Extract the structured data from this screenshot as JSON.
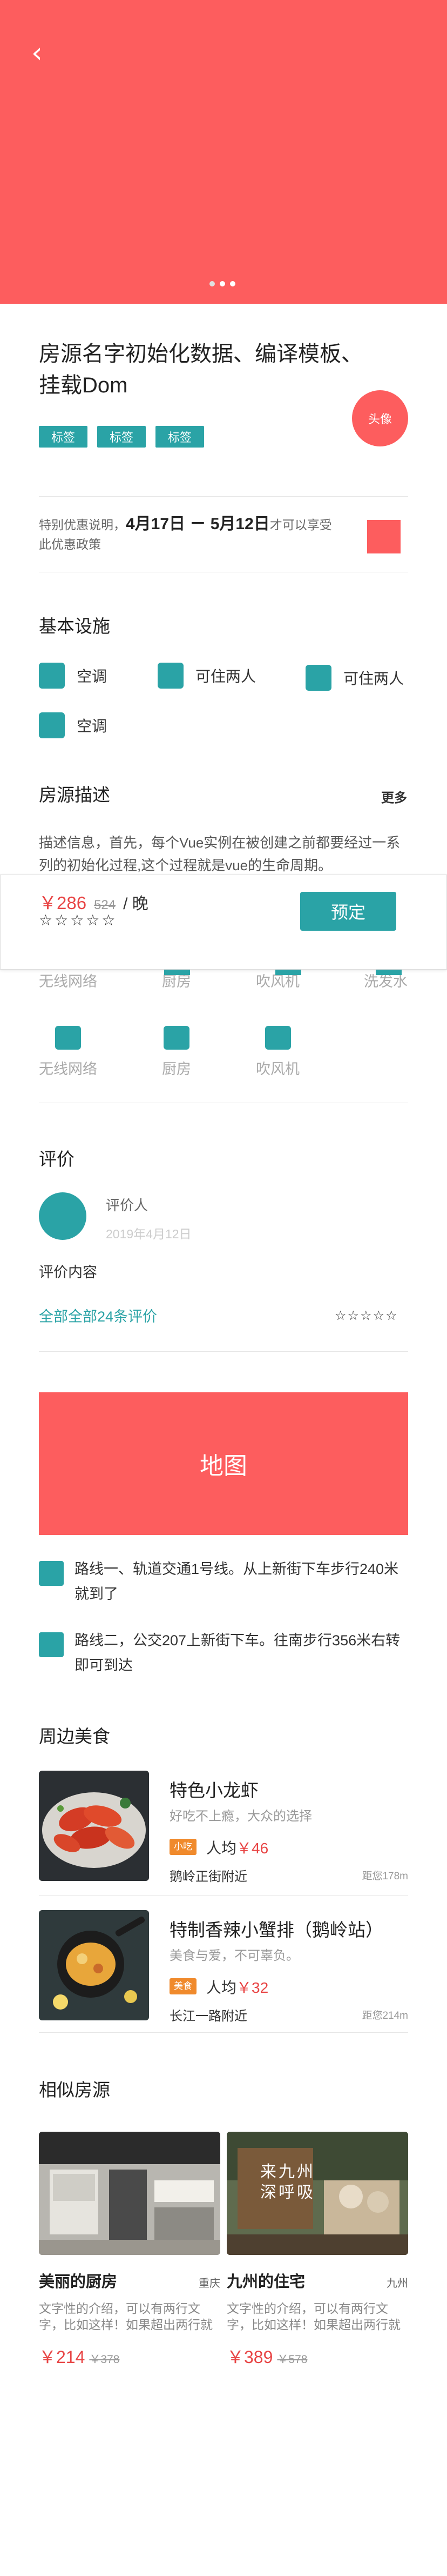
{
  "hero": {
    "dots": 3
  },
  "header": {
    "title": "房源名字初始化数据、编译模板、挂载Dom",
    "avatar_label": "头像"
  },
  "tags": [
    "标签",
    "标签",
    "标签"
  ],
  "promo": {
    "prefix": "特别优惠说明，",
    "dates": "4月17日 － 5月12日",
    "suffix": "才可以享受此优惠政策"
  },
  "facilities": {
    "title": "基本设施",
    "items": [
      "空调",
      "可住两人",
      "可住两人",
      "空调"
    ]
  },
  "description": {
    "title": "房源描述",
    "more": "更多",
    "text": "描述信息，首先，每个Vue实例在被创建之前都要经过一系列的初始化过程,这个过程就是vue的生命周期。"
  },
  "booking": {
    "price": "￥286",
    "old_price": "524",
    "unit": "/ 晚",
    "stars": "☆☆☆☆☆",
    "button": "预定"
  },
  "amenities": {
    "row1": [
      "无线网络",
      "厨房",
      "吹风机",
      "洗发水"
    ],
    "row2": [
      "无线网络",
      "厨房",
      "吹风机"
    ]
  },
  "reviews": {
    "title": "评价",
    "reviewer": "评价人",
    "date": "2019年4月12日",
    "content": "评价内容",
    "all_link": "全部全部24条评价",
    "stars": "☆☆☆☆☆"
  },
  "map": {
    "label": "地图"
  },
  "routes": [
    "路线一、轨道交通1号线。从上新街下车步行240米就到了",
    "路线二，公交207上新街下车。往南步行356米右转即可到达"
  ],
  "food": {
    "title": "周边美食",
    "items": [
      {
        "name": "特色小龙虾",
        "sub": "好吃不上瘾，大众的选择",
        "badge": "小吃",
        "avg_label": "人均",
        "avg": "￥46",
        "addr": "鹅岭正街附近",
        "dist": "距您178m"
      },
      {
        "name": "特制香辣小蟹排（鹅岭站）",
        "sub": "美食与爱，不可辜负。",
        "badge": "美食",
        "avg_label": "人均",
        "avg": "￥32",
        "addr": "长江一路附近",
        "dist": "距您214m"
      }
    ]
  },
  "similar": {
    "title": "相似房源",
    "items": [
      {
        "name": "美丽的厨房",
        "city": "重庆",
        "desc": "文字性的介绍，可以有两行文字，比如这样！如果超出两行就省略",
        "price": "￥214",
        "old": "￥378"
      },
      {
        "name": "九州的住宅",
        "city": "九州",
        "desc": "文字性的介绍，可以有两行文字，比如这样！如果超出两行就省略",
        "price": "￥389",
        "old": "￥578",
        "sign": "来九州 深呼吸"
      }
    ]
  },
  "colors": {
    "accent": "#fd5d5e",
    "teal": "#2aa3a6",
    "price": "#e84545"
  }
}
